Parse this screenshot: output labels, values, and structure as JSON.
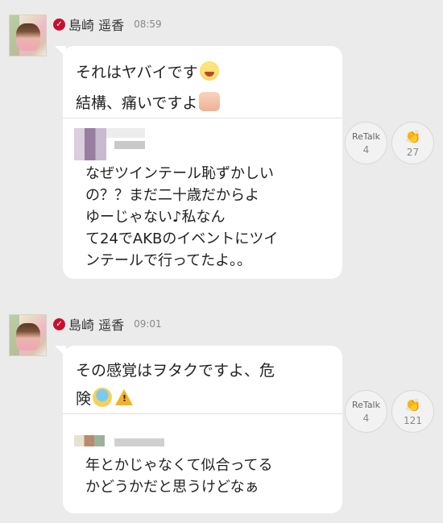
{
  "posts": [
    {
      "author": "島崎 遥香",
      "verified_icon": "check-badge",
      "time": "08:59",
      "lines": [
        "それはヤバイです",
        "結構、痛いですよ"
      ],
      "line_emojis": [
        "laughing-crying-emoji",
        "thumbs-up-emoji"
      ],
      "quote_lines": [
        "なぜツインテール恥ずかしい",
        "の？？まだ二十歳だからよ",
        "ゆーじゃない♪私なん",
        "て24でAKBのイベントにツイ",
        "ンテールで行ってたよ。。"
      ],
      "retalk": {
        "label": "ReTalk",
        "count": "4"
      },
      "clap": {
        "icon": "clapping-hands-icon",
        "count": "27"
      }
    },
    {
      "author": "島崎 遥香",
      "verified_icon": "check-badge",
      "time": "09:01",
      "lines": [
        "その感覚はヲタクですよ、危",
        "険"
      ],
      "line_emojis": [
        "screaming-face-emoji",
        "warning-emoji"
      ],
      "quote_lines": [
        "年とかじゃなくて似合ってる",
        "かどうかだと思うけどなぁ"
      ],
      "retalk": {
        "label": "ReTalk",
        "count": "4"
      },
      "clap": {
        "icon": "clapping-hands-icon",
        "count": "121"
      }
    }
  ],
  "colors": {
    "background": "#ebebeb",
    "bubble": "#ffffff",
    "badge": "#c8102e"
  }
}
